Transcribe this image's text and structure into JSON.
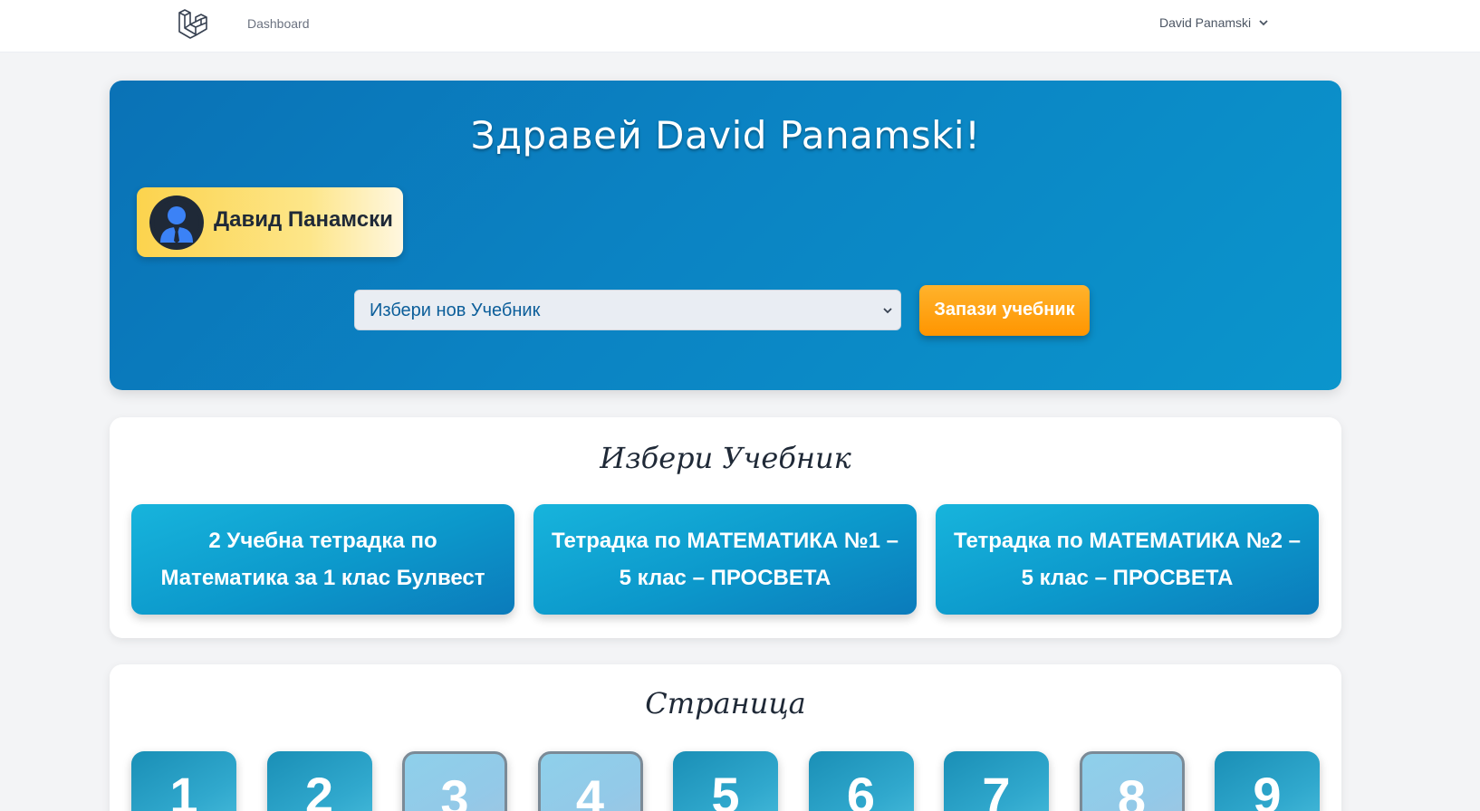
{
  "nav": {
    "logo_icon": "laravel-logo-icon",
    "dashboard_label": "Dashboard",
    "user_name": "David Panamski",
    "chevron_icon": "chevron-down-icon"
  },
  "hero": {
    "title": "Здравей David Panamski!",
    "profile_name": "Давид Панамски",
    "avatar_icon": "user-avatar-icon",
    "select_placeholder": "Избери нов Учебник",
    "save_button": "Запази учебник",
    "colors": {
      "gradient_start": "#0a72b6",
      "gradient_end": "#0b95cc",
      "button": "#ff9f1a",
      "profile_card": "#fcd34d"
    }
  },
  "books": {
    "title": "Избери Учебник",
    "items": [
      {
        "label": "2 Учебна тетрадка по Математика за 1 клас Булвест"
      },
      {
        "label": "Тетрадка по МАТЕМАТИКА №1 – 5 клас – ПРОСВЕТА"
      },
      {
        "label": "Тетрадка по МАТЕМАТИКА №2 – 5 клас – ПРОСВЕТА"
      }
    ]
  },
  "pages": {
    "title": "Страница",
    "items": [
      {
        "number": "1",
        "style": "dark"
      },
      {
        "number": "2",
        "style": "dark"
      },
      {
        "number": "3",
        "style": "light"
      },
      {
        "number": "4",
        "style": "light"
      },
      {
        "number": "5",
        "style": "dark"
      },
      {
        "number": "6",
        "style": "dark"
      },
      {
        "number": "7",
        "style": "dark"
      },
      {
        "number": "8",
        "style": "light"
      },
      {
        "number": "9",
        "style": "dark"
      }
    ]
  }
}
